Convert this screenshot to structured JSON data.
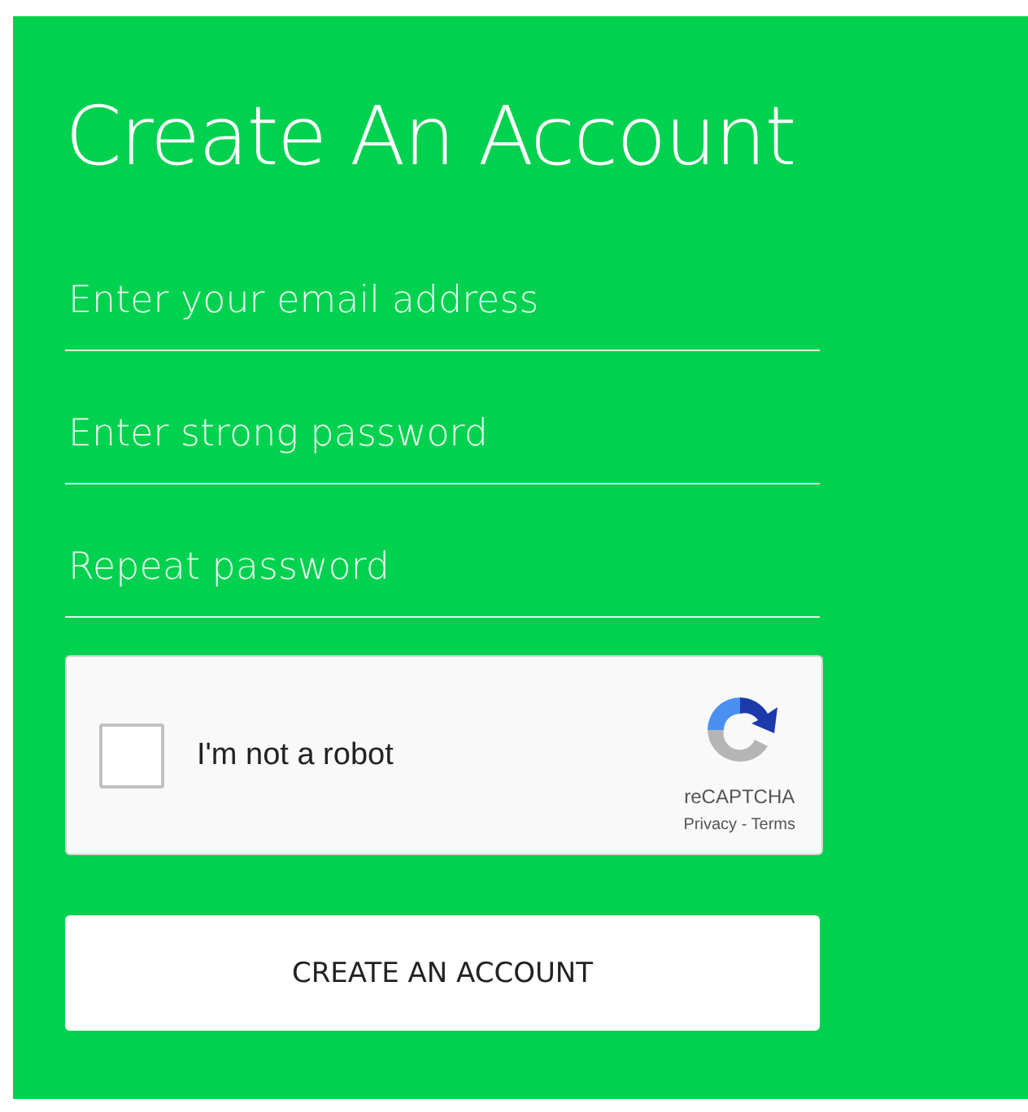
{
  "title": "Create An Account",
  "fields": [
    {
      "placeholder": "Enter your email address"
    },
    {
      "placeholder": "Enter strong password"
    },
    {
      "placeholder": "Repeat password"
    }
  ],
  "captcha": {
    "label": "I'm not a robot",
    "checked": false,
    "brand": "reCAPTCHA",
    "links": [
      "Privacy",
      "Terms"
    ],
    "separator": "-"
  },
  "submit": "CREATE AN ACCOUNT"
}
